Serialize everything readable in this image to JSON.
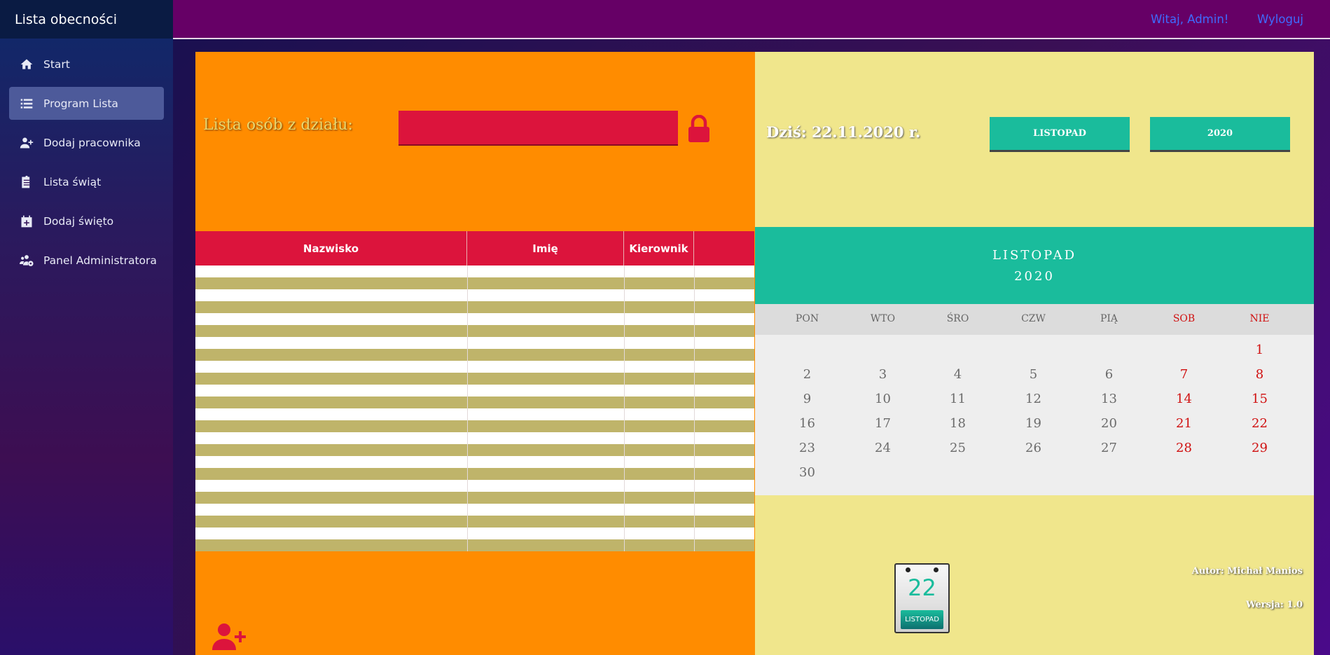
{
  "sidebar": {
    "brand": "Lista obecności",
    "items": [
      {
        "label": "Start",
        "icon": "home-icon"
      },
      {
        "label": "Program Lista",
        "icon": "list-icon"
      },
      {
        "label": "Dodaj pracownika",
        "icon": "user-plus-icon"
      },
      {
        "label": "Lista świąt",
        "icon": "clipboard-list-icon"
      },
      {
        "label": "Dodaj święto",
        "icon": "calendar-plus-icon"
      },
      {
        "label": "Panel Administratora",
        "icon": "users-cog-icon"
      }
    ]
  },
  "header": {
    "greeting": "Witaj, Admin!",
    "logout": "Wyloguj"
  },
  "department": {
    "label": "Lista osób z działu:",
    "selected": ""
  },
  "table": {
    "columns": [
      "Nazwisko",
      "Imię",
      "Kierownik",
      ""
    ],
    "rows": []
  },
  "today": {
    "text": "Dziś: 22.11.2020 r."
  },
  "selectors": {
    "month": "LISTOPAD",
    "year": "2020"
  },
  "calendar": {
    "month": "LISTOPAD",
    "year": "2020",
    "weekdays": [
      "PON",
      "WTO",
      "ŚRO",
      "CZW",
      "PIĄ",
      "SOB",
      "NIE"
    ],
    "weeks": [
      [
        "",
        "",
        "",
        "",
        "",
        "",
        "1"
      ],
      [
        "2",
        "3",
        "4",
        "5",
        "6",
        "7",
        "8"
      ],
      [
        "9",
        "10",
        "11",
        "12",
        "13",
        "14",
        "15"
      ],
      [
        "16",
        "17",
        "18",
        "19",
        "20",
        "21",
        "22"
      ],
      [
        "23",
        "24",
        "25",
        "26",
        "27",
        "28",
        "29"
      ],
      [
        "30",
        "",
        "",
        "",
        "",
        "",
        ""
      ]
    ]
  },
  "mini_calendar": {
    "day": "22",
    "month": "LISTOPAD"
  },
  "footer": {
    "author": "Autor: Michał Manios",
    "version": "Wersja: 1.0"
  },
  "colors": {
    "orange_panel": "#ff8c00",
    "khaki_panel": "#f0e68c",
    "crimson": "#dc143c",
    "teal": "#1abc9c",
    "weekend_red": "#d01010"
  }
}
